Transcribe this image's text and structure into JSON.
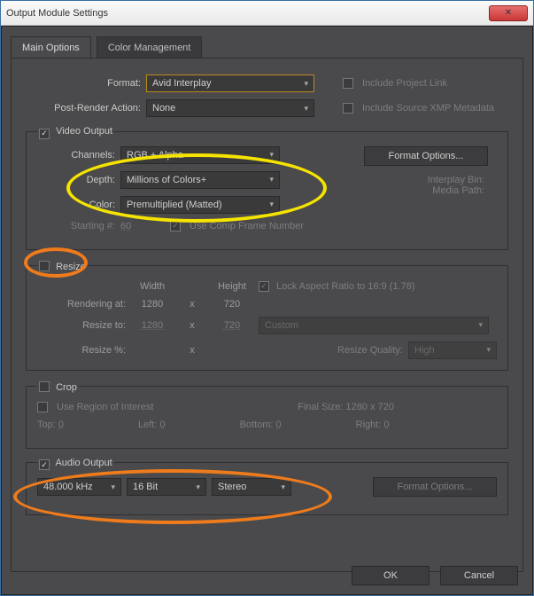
{
  "window": {
    "title": "Output Module Settings"
  },
  "tabs": [
    "Main Options",
    "Color Management"
  ],
  "top": {
    "format_label": "Format:",
    "format_value": "Avid Interplay",
    "post_render_label": "Post-Render Action:",
    "post_render_value": "None",
    "include_project_link": "Include Project Link",
    "include_source_xmp": "Include Source XMP Metadata"
  },
  "video": {
    "legend": "Video Output",
    "channels_label": "Channels:",
    "channels_value": "RGB + Alpha",
    "depth_label": "Depth:",
    "depth_value": "Millions of Colors+",
    "color_label": "Color:",
    "color_value": "Premultiplied (Matted)",
    "starting_label": "Starting #:",
    "starting_value": "60",
    "use_comp_frame": "Use Comp Frame Number",
    "format_options_btn": "Format Options...",
    "interplay_bin": "Interplay Bin:",
    "media_path": "Media Path:"
  },
  "resize": {
    "legend": "Resize",
    "width_hdr": "Width",
    "height_hdr": "Height",
    "lock_ar": "Lock Aspect Ratio to",
    "lock_ar_value": "16:9 (1.78)",
    "rendering_at": "Rendering at:",
    "render_w": "1280",
    "render_h": "720",
    "resize_to": "Resize to:",
    "resize_w": "1280",
    "resize_h": "720",
    "preset": "Custom",
    "resize_pct": "Resize %:",
    "quality_label": "Resize Quality:",
    "quality_value": "High"
  },
  "crop": {
    "legend": "Crop",
    "use_roi": "Use Region of Interest",
    "final_size": "Final Size: 1280 x 720",
    "top": "Top:",
    "top_v": "0",
    "left": "Left:",
    "left_v": "0",
    "bottom": "Bottom:",
    "bottom_v": "0",
    "right": "Right:",
    "right_v": "0"
  },
  "audio": {
    "legend": "Audio Output",
    "rate": "48.000 kHz",
    "depth": "16 Bit",
    "channels": "Stereo",
    "format_options_btn": "Format Options..."
  },
  "buttons": {
    "ok": "OK",
    "cancel": "Cancel"
  }
}
